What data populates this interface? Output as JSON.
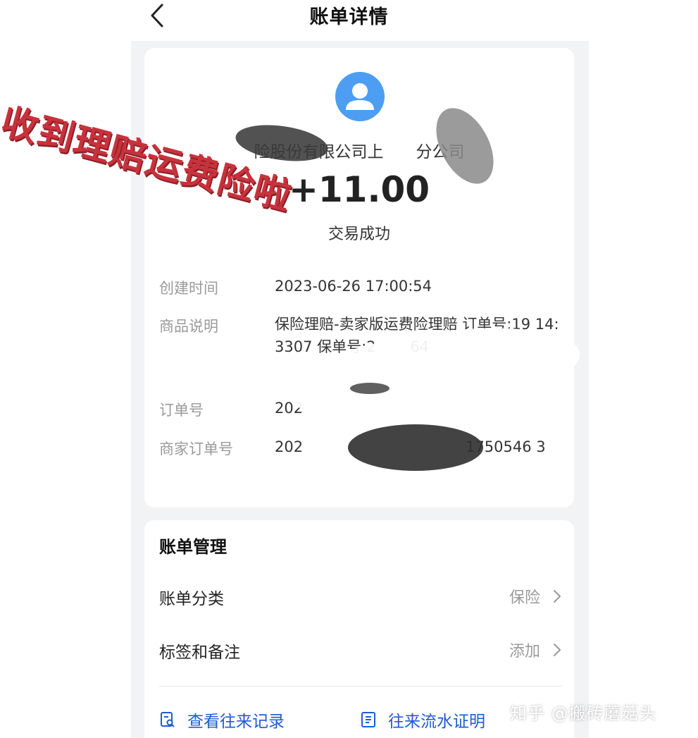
{
  "nav": {
    "title": "账单详情",
    "back_icon": "chevron-left-icon"
  },
  "header": {
    "avatar_icon": "user-avatar-icon",
    "avatar_color": "#4d9ef3",
    "merchant_name": "险股份有限公司上　　分公司",
    "amount": "+11.00",
    "status": "交易成功"
  },
  "details": [
    {
      "label": "创建时间",
      "value": "2023-06-26 17:00:54"
    },
    {
      "label": "商品说明",
      "value": "保险理赔-卖家版运费险理赔 订单号:19 14:　　　　　　3307 保单号:2　　 64"
    },
    {
      "label": "订单号",
      "value": "202"
    },
    {
      "label": "商家订单号",
      "value": "202　　　　　　　　　　　1750546 3"
    }
  ],
  "management": {
    "title": "账单管理",
    "rows": [
      {
        "label": "账单分类",
        "value": "保险"
      },
      {
        "label": "标签和备注",
        "value": "添加"
      }
    ]
  },
  "links": [
    {
      "label": "查看往来记录",
      "icon": "record-search-icon"
    },
    {
      "label": "往来流水证明",
      "icon": "statement-doc-icon"
    }
  ],
  "overlay": {
    "stamp_text": "收到理赔运费险啦",
    "stamp_color": "#c8323c",
    "watermark": "知乎 @搬砖蘑菇头"
  },
  "colors": {
    "link": "#1f5bd1",
    "label_gray": "#9a9a9a",
    "page_bg": "#f2f3f5"
  }
}
